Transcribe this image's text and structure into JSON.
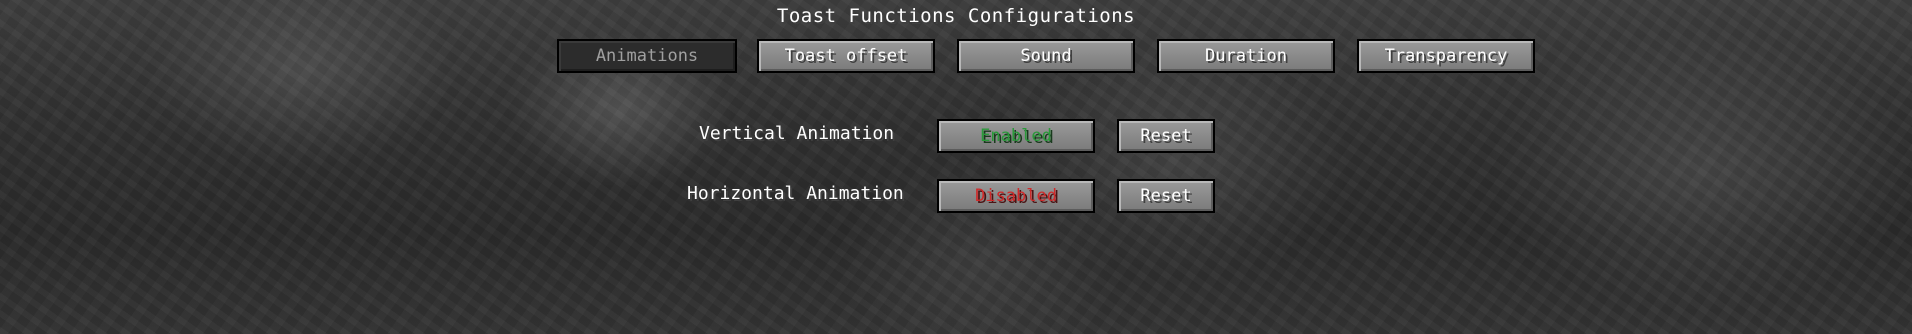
{
  "screen": {
    "title": "Toast Functions Configurations"
  },
  "tabs": [
    {
      "label": "Animations",
      "active": true
    },
    {
      "label": "Toast offset",
      "active": false
    },
    {
      "label": "Sound",
      "active": false
    },
    {
      "label": "Duration",
      "active": false
    },
    {
      "label": "Transparency",
      "active": false
    }
  ],
  "settings": [
    {
      "label": "Vertical Animation",
      "value": "Enabled",
      "reset_label": "Reset"
    },
    {
      "label": "Horizontal Animation",
      "value": "Disabled",
      "reset_label": "Reset"
    }
  ],
  "colors": {
    "enabled": "#2a9a3a",
    "disabled": "#d02a2a"
  }
}
